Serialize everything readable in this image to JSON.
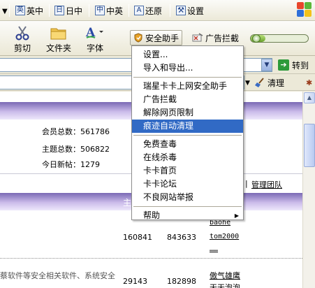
{
  "topbar": {
    "items": [
      {
        "icon": "英",
        "label": "英中"
      },
      {
        "icon": "日",
        "label": "日中"
      },
      {
        "icon": "中",
        "label": "中英"
      },
      {
        "icon": "A",
        "label": "还原"
      }
    ],
    "settings_label": "设置"
  },
  "toolbar": {
    "cut_label": "剪切",
    "folder_label": "文件夹",
    "font_label": "字体",
    "security_label": "安全助手",
    "adblock_label": "广告拦截",
    "slider_level": 0.25
  },
  "addressbar": {
    "go_label": "转到"
  },
  "linksbar": {
    "clean_label": "清理"
  },
  "page": {
    "stats": [
      {
        "label": "会员总数：561786"
      },
      {
        "label": "主题总数：506822"
      },
      {
        "label": "今日新帖：1279"
      }
    ],
    "team_link": "管理团队",
    "band_text": "主",
    "rows": [
      {
        "num1": "160841",
        "num2": "843633",
        "users": [
          "baohe",
          "tom2000",
          "……"
        ]
      },
      {
        "desc": "蔡软件等安全相关软件、系统安全",
        "num1": "29143",
        "num2": "182898",
        "users": [
          "傲气雄鹰",
          "天天泡泡"
        ]
      }
    ]
  },
  "menu": {
    "group1": [
      "设置...",
      "导入和导出..."
    ],
    "group2": [
      "瑞星卡卡上网安全助手",
      "广告拦截",
      "解除网页限制",
      "痕迹自动清理"
    ],
    "group3": [
      "免费查毒",
      "在线杀毒",
      "卡卡首页",
      "卡卡论坛",
      "不良网站举报"
    ],
    "group4": [
      "帮助"
    ],
    "highlighted": "痕迹自动清理"
  }
}
